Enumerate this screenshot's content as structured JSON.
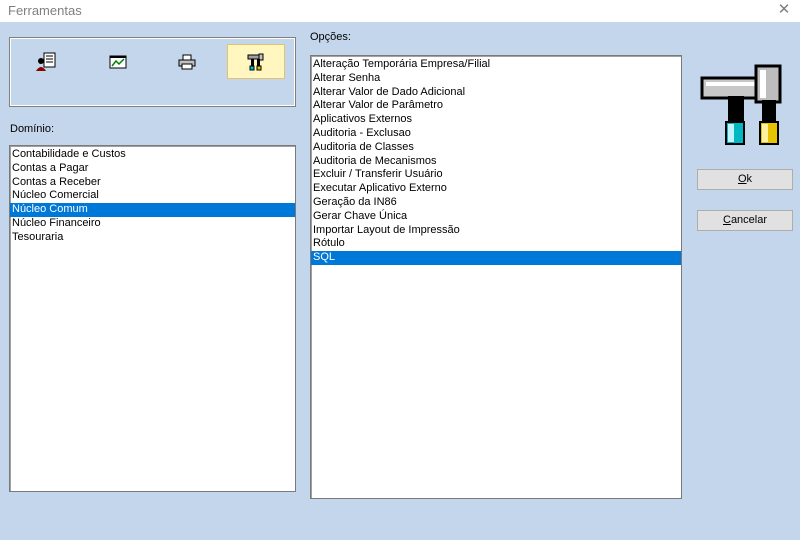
{
  "window": {
    "title": "Ferramentas",
    "close_glyph": "✕"
  },
  "toolbar": {
    "buttons": [
      {
        "icon": "user-document-icon"
      },
      {
        "icon": "chart-window-icon"
      },
      {
        "icon": "printer-icon"
      },
      {
        "icon": "tools-hammer-icon",
        "active": true
      }
    ]
  },
  "dominio": {
    "label": "Domínio:",
    "items": [
      "Contabilidade e Custos",
      "Contas a Pagar",
      "Contas a Receber",
      "Núcleo Comercial",
      "Núcleo Comum",
      "Núcleo Financeiro",
      "Tesouraria"
    ],
    "selected": "Núcleo Comum"
  },
  "opcoes": {
    "label": "Opções:",
    "items": [
      "Alteração Temporária Empresa/Filial",
      "Alterar Senha",
      "Alterar Valor de Dado Adicional",
      "Alterar Valor de Parâmetro",
      "Aplicativos Externos",
      "Auditoria - Exclusao",
      "Auditoria de Classes",
      "Auditoria de Mecanismos",
      "Excluir / Transferir Usuário",
      "Executar Aplicativo Externo",
      "Geração da IN86",
      "Gerar Chave Única",
      "Importar Layout de Impressão",
      "Rótulo",
      "SQL"
    ],
    "selected": "SQL"
  },
  "buttons": {
    "ok": {
      "mnemonic": "O",
      "rest": "k"
    },
    "cancel": {
      "mnemonic": "C",
      "rest": "ancelar"
    }
  },
  "colors": {
    "selection": "#0078d7",
    "background": "#c4d6ec",
    "active_tool": "#fff7bf"
  }
}
